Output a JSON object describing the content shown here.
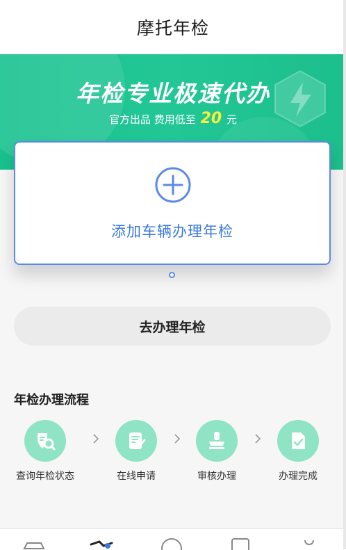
{
  "header": {
    "title": "摩托年检"
  },
  "banner": {
    "slogan": "年检专业极速代办",
    "subline_prefix": "官方出品  费用低至",
    "price": "20",
    "unit": "元",
    "accent_color": "#1fc592",
    "price_color": "#f5f03c"
  },
  "add_card": {
    "label": "添加车辆办理年检",
    "icon": "plus-circle-icon",
    "border_color": "#5b89e6"
  },
  "carousel": {
    "active_index": 1,
    "count": 1
  },
  "action": {
    "go_label": "去办理年检"
  },
  "process": {
    "title": "年检办理流程",
    "steps": [
      {
        "label": "查询年检状态",
        "icon": "search-shield-icon"
      },
      {
        "label": "在线申请",
        "icon": "edit-document-icon"
      },
      {
        "label": "审核办理",
        "icon": "stamp-icon"
      },
      {
        "label": "办理完成",
        "icon": "check-document-icon"
      }
    ]
  },
  "tabbar": {
    "tabs": [
      {
        "icon": "car-icon"
      },
      {
        "icon": "motorcycle-icon"
      },
      {
        "icon": "violation-icon"
      },
      {
        "icon": "license-icon"
      },
      {
        "icon": "profile-icon"
      }
    ]
  }
}
